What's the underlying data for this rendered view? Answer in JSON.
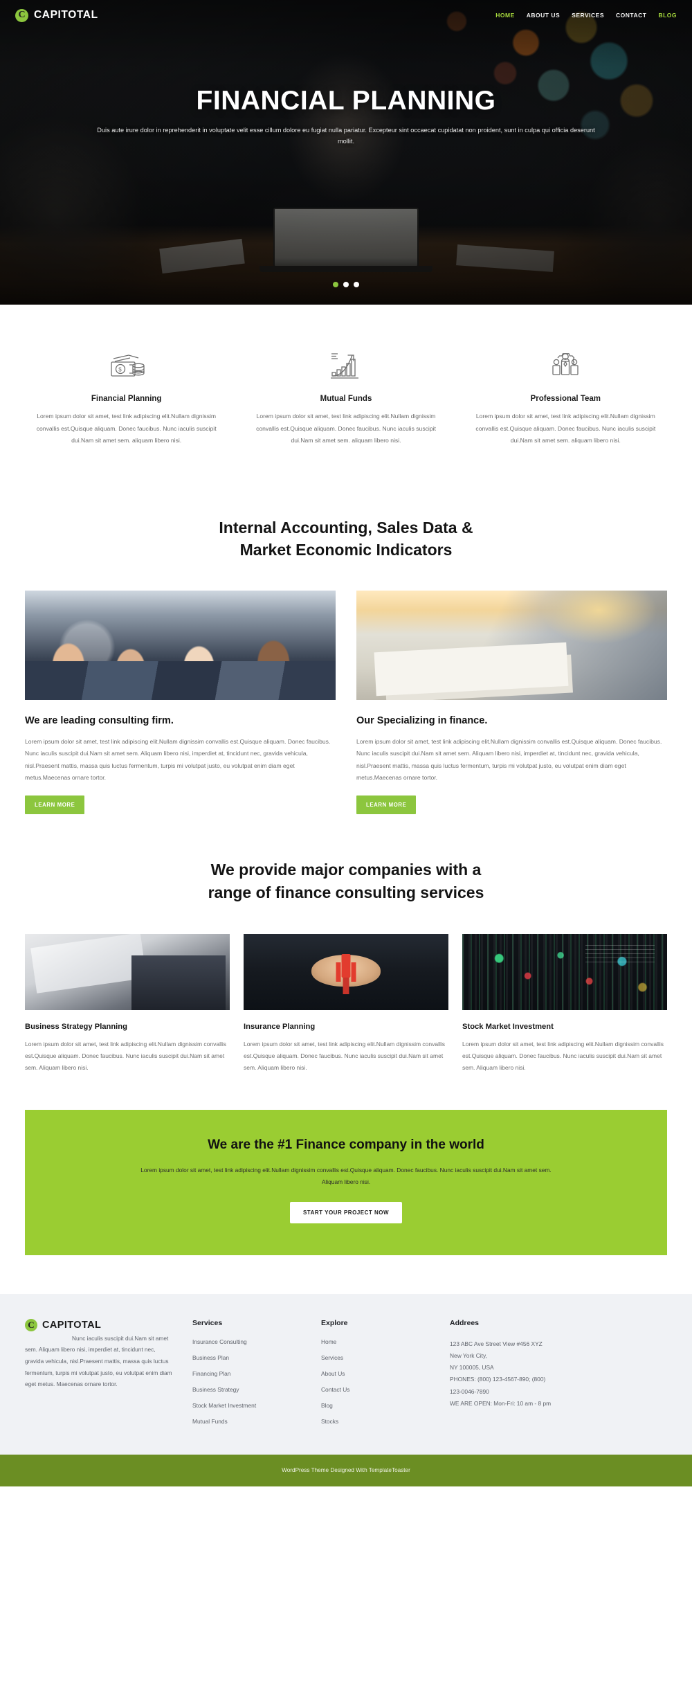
{
  "brand": {
    "mark": "C",
    "name": "CAPITOTAL"
  },
  "nav": {
    "items": [
      {
        "label": "HOME",
        "state": "active"
      },
      {
        "label": "ABOUT US",
        "state": "default"
      },
      {
        "label": "SERVICES",
        "state": "default"
      },
      {
        "label": "CONTACT",
        "state": "default"
      },
      {
        "label": "BLOG",
        "state": "accent"
      }
    ]
  },
  "hero": {
    "title": "FINANCIAL PLANNING",
    "subtitle": "Duis aute irure dolor in reprehenderit in voluptate velit esse cillum dolore eu fugiat nulla pariatur. Excepteur sint occaecat cupidatat non proident, sunt in culpa qui officia deserunt mollit.",
    "slider_dots": 3,
    "active_dot": 1,
    "active_dot_color": "#8cc63e"
  },
  "features": [
    {
      "icon": "money-bills-coins-icon",
      "title": "Financial Planning",
      "text": "Lorem ipsum dolor sit amet, test link adipiscing elit.Nullam dignissim convallis est.Quisque aliquam. Donec faucibus. Nunc iaculis suscipit dui.Nam sit amet sem. aliquam libero nisi."
    },
    {
      "icon": "growth-chart-arrow-icon",
      "title": "Mutual Funds",
      "text": "Lorem ipsum dolor sit amet, test link adipiscing elit.Nullam dignissim convallis est.Quisque aliquam. Donec faucibus. Nunc iaculis suscipit dui.Nam sit amet sem. aliquam libero nisi."
    },
    {
      "icon": "team-gear-icon",
      "title": "Professional Team",
      "text": "Lorem ipsum dolor sit amet, test link adipiscing elit.Nullam dignissim convallis est.Quisque aliquam. Donec faucibus. Nunc iaculis suscipit dui.Nam sit amet sem. aliquam libero nisi."
    }
  ],
  "section_about": {
    "heading_line1": "Internal Accounting, Sales Data &",
    "heading_line2": "Market Economic Indicators",
    "columns": [
      {
        "image": "business-networking-photo",
        "title": "We are leading consulting firm.",
        "text": "Lorem ipsum dolor sit amet, test link adipiscing elit.Nullam dignissim convallis est.Quisque aliquam. Donec faucibus. Nunc iaculis suscipit dui.Nam sit amet sem. Aliquam libero nisi, imperdiet at, tincidunt nec, gravida vehicula, nisl.Praesent mattis, massa quis luctus fermentum, turpis mi volutpat justo, eu volutpat enim diam eget metus.Maecenas ornare tortor.",
        "button": "LEARN MORE"
      },
      {
        "image": "desk-meeting-photo",
        "title": "Our Specializing in finance.",
        "text": "Lorem ipsum dolor sit amet, test link adipiscing elit.Nullam dignissim convallis est.Quisque aliquam. Donec faucibus. Nunc iaculis suscipit dui.Nam sit amet sem. Aliquam libero nisi, imperdiet at, tincidunt nec, gravida vehicula, nisl.Praesent mattis, massa quis luctus fermentum, turpis mi volutpat justo, eu volutpat enim diam eget metus.Maecenas ornare tortor.",
        "button": "LEARN MORE"
      }
    ]
  },
  "section_services": {
    "heading_line1": "We provide major companies with a",
    "heading_line2": "range of finance consulting services",
    "cards": [
      {
        "image": "laptop-handshake-photo",
        "title": "Business Strategy Planning",
        "text": "Lorem ipsum dolor sit amet, test link adipiscing elit.Nullam dignissim convallis est.Quisque aliquam. Donec faucibus. Nunc iaculis suscipit dui.Nam sit amet sem. Aliquam libero nisi."
      },
      {
        "image": "protecting-hands-family-photo",
        "title": "Insurance Planning",
        "text": "Lorem ipsum dolor sit amet, test link adipiscing elit.Nullam dignissim convallis est.Quisque aliquam. Donec faucibus. Nunc iaculis suscipit dui.Nam sit amet sem. Aliquam libero nisi."
      },
      {
        "image": "stock-ticker-board-photo",
        "title": "Stock Market Investment",
        "text": "Lorem ipsum dolor sit amet, test link adipiscing elit.Nullam dignissim convallis est.Quisque aliquam. Donec faucibus. Nunc iaculis suscipit dui.Nam sit amet sem. Aliquam libero nisi."
      }
    ]
  },
  "cta": {
    "title": "We are the #1 Finance company in the world",
    "text": "Lorem ipsum dolor sit amet, test link adipiscing elit.Nullam dignissim convallis est.Quisque aliquam. Donec faucibus. Nunc iaculis suscipit dui.Nam sit amet sem. Aliquam libero nisi.",
    "button": "START YOUR PROJECT NOW",
    "background_color": "#9acd32"
  },
  "footer": {
    "brand": {
      "mark": "C",
      "name": "CAPITOTAL"
    },
    "about": "Nunc iaculis suscipit dui.Nam sit amet sem. Aliquam libero nisi, imperdiet at, tincidunt nec, gravida vehicula, nisl.Praesent mattis, massa quis luctus fermentum, turpis mi volutpat justo, eu volutpat enim diam eget metus. Maecenas ornare tortor.",
    "services": {
      "heading": "Services",
      "items": [
        "Insurance Consulting",
        "Business Plan",
        "Financing Plan",
        "Business Strategy",
        "Stock Market Investment",
        "Mutual Funds"
      ]
    },
    "explore": {
      "heading": "Explore",
      "items": [
        "Home",
        "Services",
        "About Us",
        "Contact Us",
        "Blog",
        "Stocks"
      ]
    },
    "address": {
      "heading": "Addrees",
      "lines": [
        "123 ABC Ave Street View #456 XYZ",
        "New York City,",
        "NY 100005, USA",
        "PHONES: (800) 123-4567-890; (800)",
        "123-0046-7890",
        "WE ARE OPEN: Mon-Fri: 10 am - 8 pm"
      ]
    }
  },
  "bottombar": {
    "text": "WordPress Theme Designed With TemplateToaster",
    "background_color": "#6b8e23"
  },
  "colors": {
    "accent_green": "#8cc63e",
    "cta_green": "#9acd32",
    "footer_bg": "#f0f2f5",
    "bottom_green": "#6b8e23"
  }
}
